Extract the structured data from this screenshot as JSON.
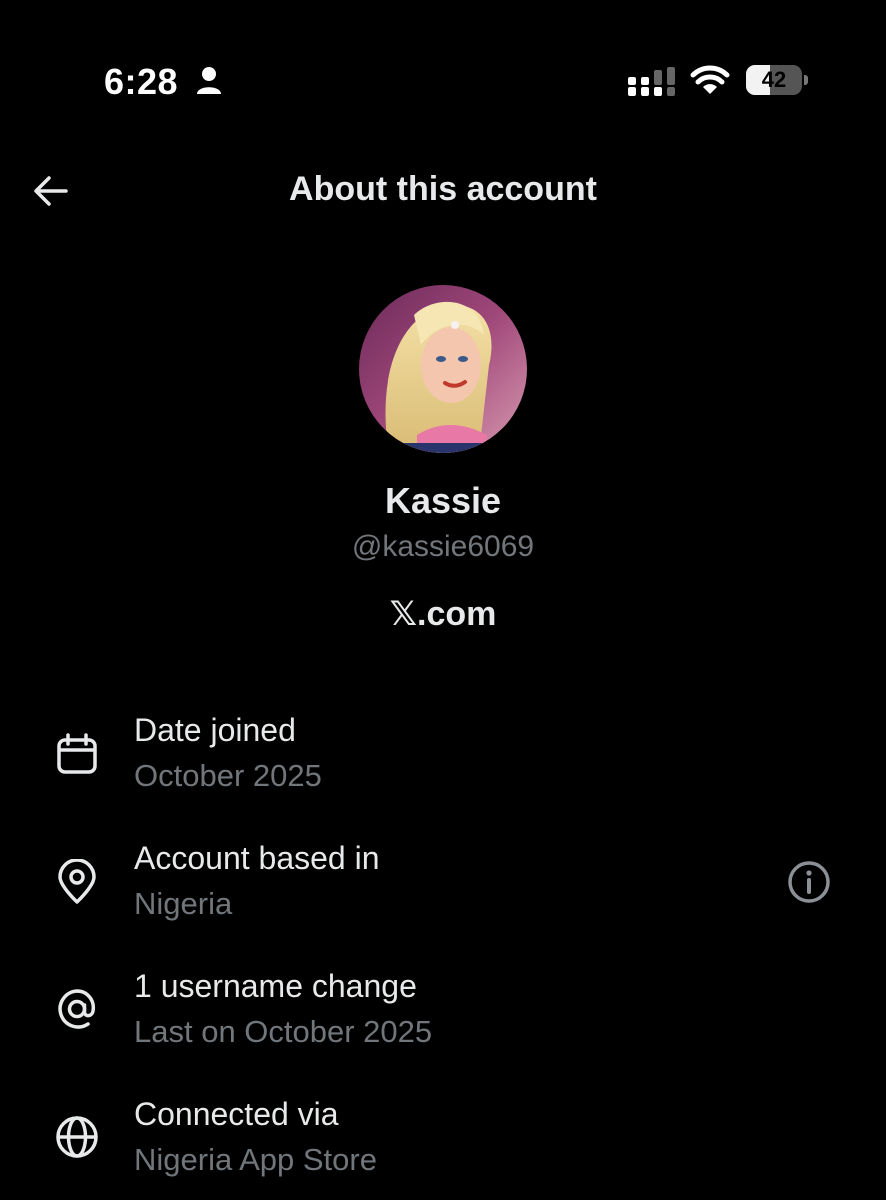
{
  "status_bar": {
    "time": "6:28",
    "battery_percent": 42,
    "battery_label": "42",
    "icons": [
      "person-icon",
      "signal-icon",
      "wifi-icon",
      "battery-icon"
    ]
  },
  "header": {
    "title": "About this account",
    "back_icon": "arrow-left-icon"
  },
  "profile": {
    "name": "Kassie",
    "handle": "@kassie6069",
    "link": "𝕏.com"
  },
  "rows": [
    {
      "icon": "calendar-icon",
      "title": "Date joined",
      "subtitle": "October 2025"
    },
    {
      "icon": "location-pin-icon",
      "title": "Account based in",
      "subtitle": "Nigeria",
      "trailing_icon": "info-icon"
    },
    {
      "icon": "at-sign-icon",
      "title": "1 username change",
      "subtitle": "Last on October 2025"
    },
    {
      "icon": "globe-icon",
      "title": "Connected via",
      "subtitle": "Nigeria App Store"
    }
  ],
  "colors": {
    "background": "#000000",
    "primary_text": "#e7e9ea",
    "secondary_text": "#71767b"
  }
}
